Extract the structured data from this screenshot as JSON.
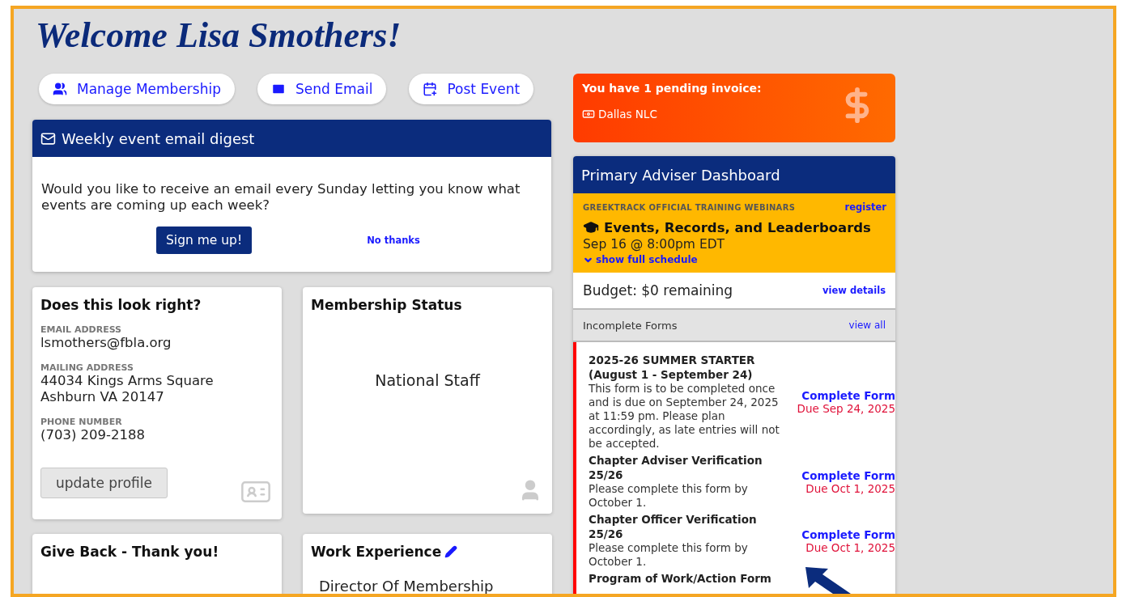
{
  "welcome": "Welcome Lisa Smothers!",
  "actions": [
    {
      "kind": "members",
      "label": "Manage Membership"
    },
    {
      "kind": "email",
      "label": "Send Email"
    },
    {
      "kind": "event",
      "label": "Post Event"
    }
  ],
  "digest": {
    "title": "Weekly event email digest",
    "message": "Would you like to receive an email every Sunday letting you know what events are coming up each week?",
    "confirm": "Sign me up!",
    "decline": "No thanks"
  },
  "profile_card": {
    "title": "Does this look right?",
    "fields": [
      {
        "label": "EMAIL ADDRESS",
        "lines": [
          "lsmothers@fbla.org"
        ]
      },
      {
        "label": "MAILING ADDRESS",
        "lines": [
          "44034 Kings Arms Square",
          "Ashburn VA 20147"
        ]
      },
      {
        "label": "PHONE NUMBER",
        "lines": [
          "(703) 209-2188"
        ]
      }
    ],
    "button": "update profile"
  },
  "membership_card": {
    "title": "Membership Status",
    "status": "National Staff"
  },
  "give_back_card": {
    "title": "Give Back - Thank you!"
  },
  "work_card": {
    "title": "Work Experience",
    "items": [
      "Director Of Membership"
    ]
  },
  "invoice": {
    "title": "You have 1 pending invoice:",
    "items": [
      "Dallas NLC"
    ]
  },
  "dashboard": {
    "title": "Primary Adviser Dashboard",
    "webinar": {
      "eyebrow": "GREEKTRACK OFFICIAL TRAINING WEBINARS",
      "register": "register",
      "title": "Events, Records, and Leaderboards",
      "time": "Sep 16 @ 8:00pm EDT",
      "toggle": "show full schedule"
    },
    "budget": {
      "text": "Budget: $0 remaining",
      "link": "view details"
    },
    "forms": {
      "title": "Incomplete Forms",
      "link": "view all",
      "items": [
        {
          "title": "2025-26 SUMMER STARTER (August 1 - September 24)",
          "description": "This form is to be completed once and is due on September 24, 2025 at 11:59 pm.  Please plan accordingly, as late entries will not be accepted.",
          "action": "Complete Form",
          "due": "Due Sep 24, 2025"
        },
        {
          "title": "Chapter Adviser Verification 25/26",
          "description": "Please complete this form by October 1.",
          "action": "Complete Form",
          "due": "Due Oct 1, 2025"
        },
        {
          "title": "Chapter Officer Verification 25/26",
          "description": "Please complete this form by October 1.",
          "action": "Complete Form",
          "due": "Due Oct 1, 2025"
        },
        {
          "title": "Program of Work/Action Form"
        }
      ]
    }
  }
}
